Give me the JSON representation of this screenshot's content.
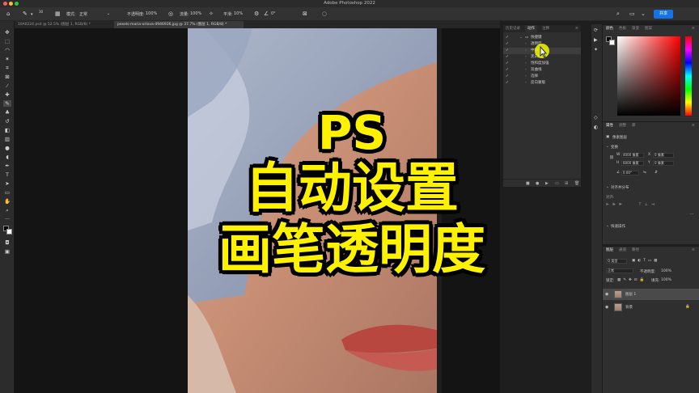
{
  "app": {
    "title": "Adobe Photoshop 2022"
  },
  "options_bar": {
    "mode_label": "模式:",
    "mode_value": "正常",
    "opacity_label": "不透明度:",
    "opacity_value": "100%",
    "flow_label": "流量:",
    "flow_value": "100%",
    "smooth_label": "平滑:",
    "smooth_value": "10%",
    "angle_value": "0°",
    "brush_size": "30",
    "share_label": "共享"
  },
  "tabs": [
    {
      "label": "1IIA0224.psd @ 52.5% (图层 1, RGB/8) *"
    },
    {
      "label": "pexels-maria-orlova-4946936.jpg @ 37.7% (图层 1, RGB/8) *"
    }
  ],
  "overlay": {
    "line1": "PS",
    "line2": "自动设置",
    "line3": "画笔透明度"
  },
  "actions_panel": {
    "tabs": [
      "历史记录",
      "动作",
      "注释"
    ],
    "rows": [
      {
        "label": "快捷键",
        "level": 0,
        "folder": true
      },
      {
        "label": "透明度",
        "level": 1
      },
      {
        "label": "中间值",
        "level": 1
      },
      {
        "label": "黑白加深",
        "level": 1
      },
      {
        "label": "饱和度加强",
        "level": 1
      },
      {
        "label": "双曲线",
        "level": 1
      },
      {
        "label": "选择",
        "level": 1
      },
      {
        "label": "反向蒙版",
        "level": 1
      }
    ]
  },
  "color_panel": {
    "tabs": [
      "颜色",
      "色板",
      "渐变",
      "图案"
    ]
  },
  "properties_panel": {
    "tabs": [
      "属性",
      "调整",
      "库"
    ],
    "pixel_layer_label": "像素图层",
    "transform_label": "变换",
    "w_label": "W",
    "w_value": "4000 像素",
    "h_label": "H",
    "h_value": "6000 像素",
    "x_label": "X",
    "x_value": "0 像素",
    "y_label": "Y",
    "y_value": "0 像素",
    "angle_value": "0.00°",
    "align_label": "对齐并分布",
    "align_sub": "对齐:",
    "quick_label": "快速操作"
  },
  "layers_panel": {
    "tabs": [
      "图层",
      "通道",
      "路径"
    ],
    "kind_label": "Q 类型",
    "blend_value": "正常",
    "opacity_label": "不透明度:",
    "opacity_value": "100%",
    "lock_label": "锁定:",
    "fill_label": "填充:",
    "fill_value": "100%",
    "layers": [
      {
        "name": "图层 1"
      },
      {
        "name": "背景"
      }
    ]
  },
  "colors": {
    "accent": "#1473e6",
    "overlay_text": "#fff200",
    "foreground": "#000000",
    "background": "#ffffff"
  }
}
